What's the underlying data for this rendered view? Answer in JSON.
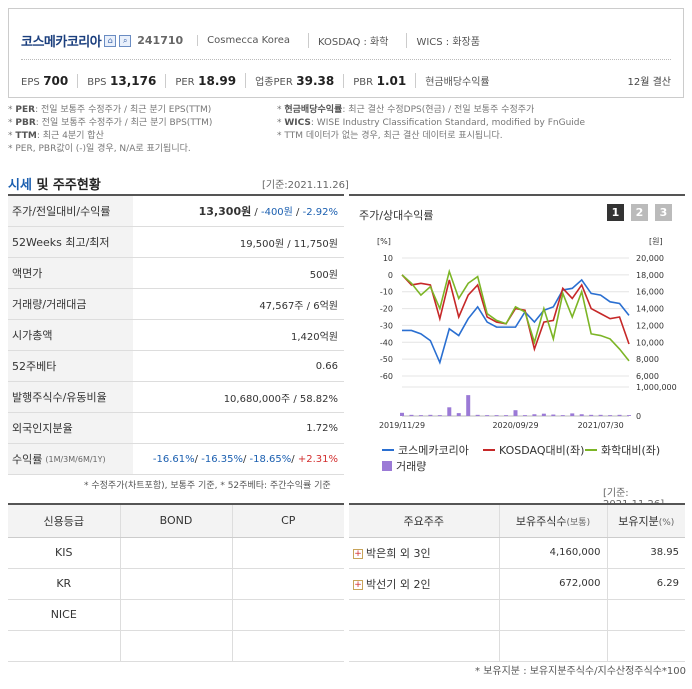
{
  "company": {
    "name": "코스메카코리아",
    "code": "241710",
    "english": "Cosmecca Korea",
    "market": "KOSDAQ : 화학",
    "wics": "WICS : 화장품",
    "settlement": "12월 결산"
  },
  "metrics": [
    {
      "label": "EPS",
      "value": "700"
    },
    {
      "label": "BPS",
      "value": "13,176"
    },
    {
      "label": "PER",
      "value": "18.99"
    },
    {
      "label": "업종PER",
      "value": "39.38"
    },
    {
      "label": "PBR",
      "value": "1.01"
    },
    {
      "label": "현금배당수익률",
      "value": ""
    }
  ],
  "notes_left": [
    {
      "term": "PER",
      "text": ": 전일 보통주 수정주가 / 최근 분기 EPS(TTM)"
    },
    {
      "term": "PBR",
      "text": ": 전일 보통주 수정주가 / 최근 분기 BPS(TTM)"
    },
    {
      "term": "TTM",
      "text": ": 최근 4분기 합산"
    },
    {
      "term": "",
      "text": "PER, PBR값이 (-)일 경우, N/A로 표기됩니다."
    }
  ],
  "notes_right": [
    {
      "term": "현금배당수익률",
      "text": ": 최근 결산 수정DPS(현금) / 전일 보통주 수정주가"
    },
    {
      "term": "WICS",
      "text": ": WISE Industry Classification Standard, modified by FnGuide"
    },
    {
      "term": "",
      "text": "TTM 데이터가 없는 경우, 최근 결산 데이터로 표시됩니다."
    }
  ],
  "market_section": {
    "title_accent": "시세",
    "title_rest": " 및 주주현황",
    "ref_date": "[기준:2021.11.26]"
  },
  "market_rows": [
    {
      "label": "주가/전일대비/수익률",
      "sub": "",
      "value": "13,300원 / -400원 / -2.92%"
    },
    {
      "label": "52Weeks 최고/최저",
      "sub": "",
      "value": "19,500원 / 11,750원"
    },
    {
      "label": "액면가",
      "sub": "",
      "value": "500원"
    },
    {
      "label": "거래량/거래대금",
      "sub": "",
      "value": "47,567주 / 6억원"
    },
    {
      "label": "시가총액",
      "sub": "",
      "value": "1,420억원"
    },
    {
      "label": "52주베타",
      "sub": "",
      "value": "0.66"
    },
    {
      "label": "발행주식수/유동비율",
      "sub": "",
      "value": "10,680,000주 / 58.82%"
    },
    {
      "label": "외국인지분율",
      "sub": "",
      "value": "1.72%"
    },
    {
      "label": "수익률",
      "sub": "(1M/3M/6M/1Y)",
      "value": ""
    }
  ],
  "price": {
    "price": "13,300원",
    "change": "-400원",
    "rate": "-2.92%"
  },
  "returns": {
    "m1": "-16.61%",
    "m3": "-16.35%",
    "m6": "-18.65%",
    "y1": "+2.31%"
  },
  "market_note": "* 수정주가(차트포함), 보통주 기준, * 52주베타: 주간수익률 기준",
  "chart_panel": {
    "title": "주가/상대수익률",
    "pages": [
      "1",
      "2",
      "3"
    ]
  },
  "chart_data": {
    "type": "line",
    "title": "주가/상대수익률",
    "xlabel": "",
    "ylabel": "[%]",
    "ylabel_right": "[원]",
    "ylim": [
      -60,
      10
    ],
    "ylim_right": [
      6000,
      20000
    ],
    "yticks": [
      10,
      0,
      -10,
      -20,
      -30,
      -40,
      -50,
      -60
    ],
    "yticks_right": [
      "20,000",
      "18,000",
      "16,000",
      "14,000",
      "12,000",
      "10,000",
      "8,000",
      "6,000"
    ],
    "volume_ticks": [
      "1,000,000",
      "0"
    ],
    "x_tick_labels": [
      "2019/11/29",
      "2020/09/29",
      "2021/07/30"
    ],
    "series": [
      {
        "name": "코스메카코리아",
        "color": "#2a6fd1",
        "values": [
          -33,
          -33,
          -35,
          -39,
          -52,
          -32,
          -36,
          -26,
          -19,
          -28,
          -31,
          -31,
          -31,
          -22,
          -28,
          -21,
          -19,
          -9,
          -8,
          -3,
          -11,
          -12,
          -16,
          -17,
          -24
        ]
      },
      {
        "name": "KOSDAQ대비(좌)",
        "color": "#c62828",
        "values": [
          0,
          -6,
          -5,
          -6,
          -26,
          -3,
          -25,
          -12,
          -6,
          -25,
          -28,
          -29,
          -20,
          -21,
          -44,
          -28,
          -27,
          -8,
          -14,
          -6,
          -20,
          -23,
          -26,
          -25,
          -41
        ]
      },
      {
        "name": "화학대비(좌)",
        "color": "#7cb526",
        "values": [
          0,
          -5,
          -12,
          -7,
          -20,
          2,
          -14,
          -5,
          -1,
          -23,
          -27,
          -29,
          -19,
          -22,
          -40,
          -20,
          -38,
          -11,
          -25,
          -10,
          -35,
          -36,
          -38,
          -44,
          -51
        ]
      }
    ],
    "volume": {
      "name": "거래량",
      "color": "#9b7ad6",
      "values": [
        110000,
        40000,
        30000,
        40000,
        30000,
        300000,
        100000,
        720000,
        40000,
        30000,
        30000,
        30000,
        200000,
        30000,
        60000,
        80000,
        50000,
        30000,
        90000,
        60000,
        40000,
        40000,
        30000,
        40000,
        30000
      ]
    }
  },
  "bottom_ref_date": "[기준: 2021.11.26]",
  "credit": {
    "headers": [
      "신용등급",
      "BOND",
      "CP"
    ],
    "rows": [
      [
        "KIS",
        "",
        ""
      ],
      [
        "KR",
        "",
        ""
      ],
      [
        "NICE",
        "",
        ""
      ],
      [
        "",
        "",
        ""
      ]
    ]
  },
  "holders": {
    "headers": [
      "주요주주",
      "보유주식수",
      "(보통)",
      "보유지분",
      "(%)"
    ],
    "rows": [
      {
        "name": "박은희 외 3인",
        "shares": "4,160,000",
        "pct": "38.95"
      },
      {
        "name": "박선기 외 2인",
        "shares": "672,000",
        "pct": "6.29"
      },
      {
        "name": "",
        "shares": "",
        "pct": ""
      },
      {
        "name": "",
        "shares": "",
        "pct": ""
      }
    ],
    "note": "* 보유지분 : 보유지분주식수/지수산정주식수*100"
  }
}
